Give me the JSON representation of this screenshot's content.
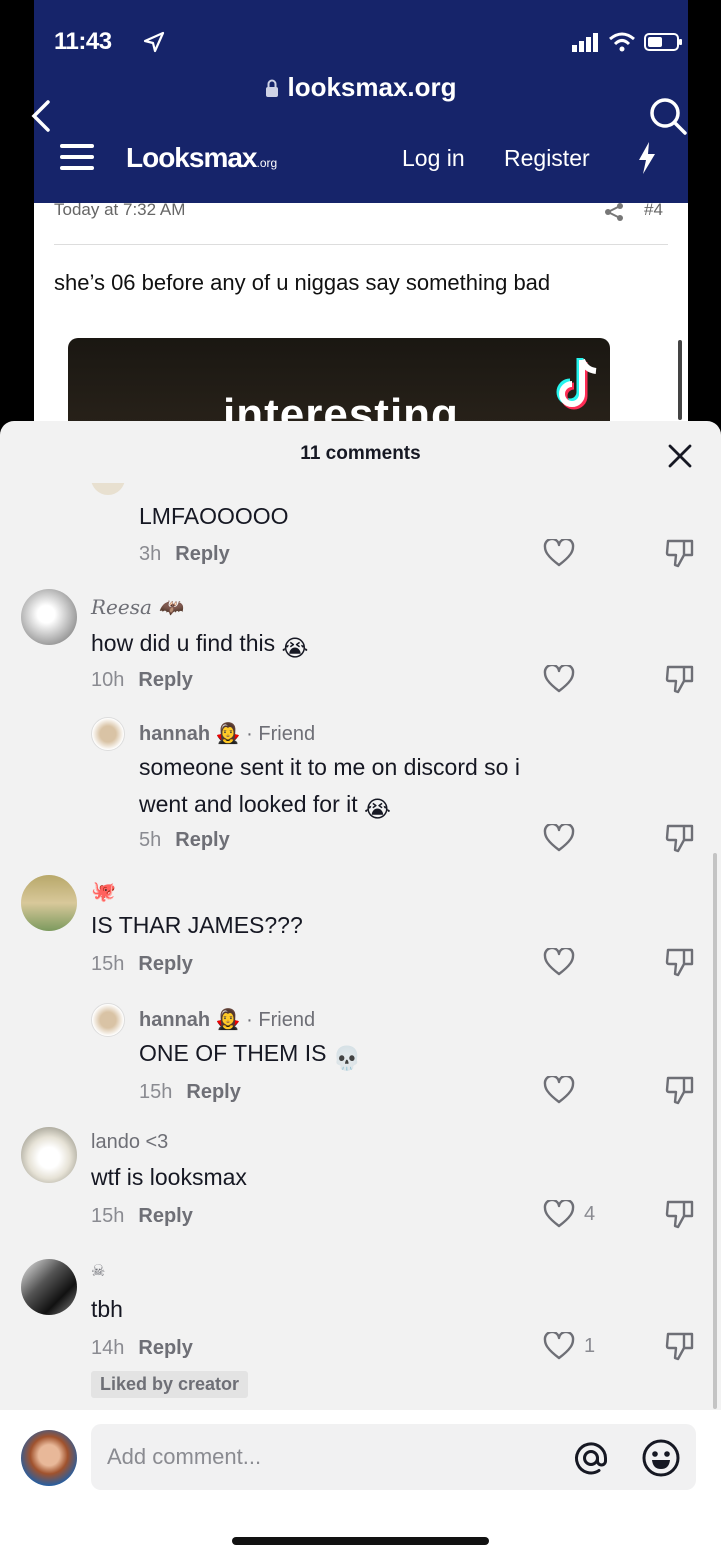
{
  "status_bar": {
    "time": "11:43"
  },
  "browser": {
    "url": "looksmax.org",
    "logo_main": "Looksmax",
    "logo_suffix": ".org",
    "login": "Log in",
    "register": "Register",
    "post_time": "Today at 7:32 AM",
    "post_number": "#4",
    "post_text": "she’s 06 before any of u niggas say something bad",
    "media_text": "interesting"
  },
  "sheet": {
    "title": "11 comments",
    "input_placeholder": "Add comment...",
    "comments": [
      {
        "id": "c0",
        "username": "",
        "text": "LMFAOOOOO",
        "time": "3h",
        "reply_label": "Reply",
        "likes": ""
      },
      {
        "id": "c1",
        "username": "Reesa",
        "text": "how did u find this",
        "emoji": "😭",
        "time": "10h",
        "reply_label": "Reply",
        "likes": ""
      },
      {
        "id": "c2",
        "username": "hannah",
        "tag": "· Friend",
        "text_line1": "someone sent it to me on discord so i",
        "text_line2": "went and looked for it",
        "emoji": "😭",
        "time": "5h",
        "reply_label": "Reply",
        "likes": ""
      },
      {
        "id": "c3",
        "username": "🐙",
        "text": "IS THAR JAMES???",
        "time": "15h",
        "reply_label": "Reply",
        "likes": ""
      },
      {
        "id": "c4",
        "username": "hannah",
        "tag": "· Friend",
        "text": "ONE OF THEM IS",
        "emoji": "💀",
        "time": "15h",
        "reply_label": "Reply",
        "likes": ""
      },
      {
        "id": "c5",
        "username": "lando <3",
        "text": "wtf is looksmax",
        "time": "15h",
        "reply_label": "Reply",
        "likes": "4"
      },
      {
        "id": "c6",
        "username": "☠",
        "text": "tbh",
        "time": "14h",
        "reply_label": "Reply",
        "likes": "1",
        "badge": "Liked by creator"
      }
    ]
  },
  "colors": {
    "navbar": "#16246a",
    "sheet_bg": "#f2f2f2",
    "text": "#161823",
    "muted": "#8a8b91"
  }
}
